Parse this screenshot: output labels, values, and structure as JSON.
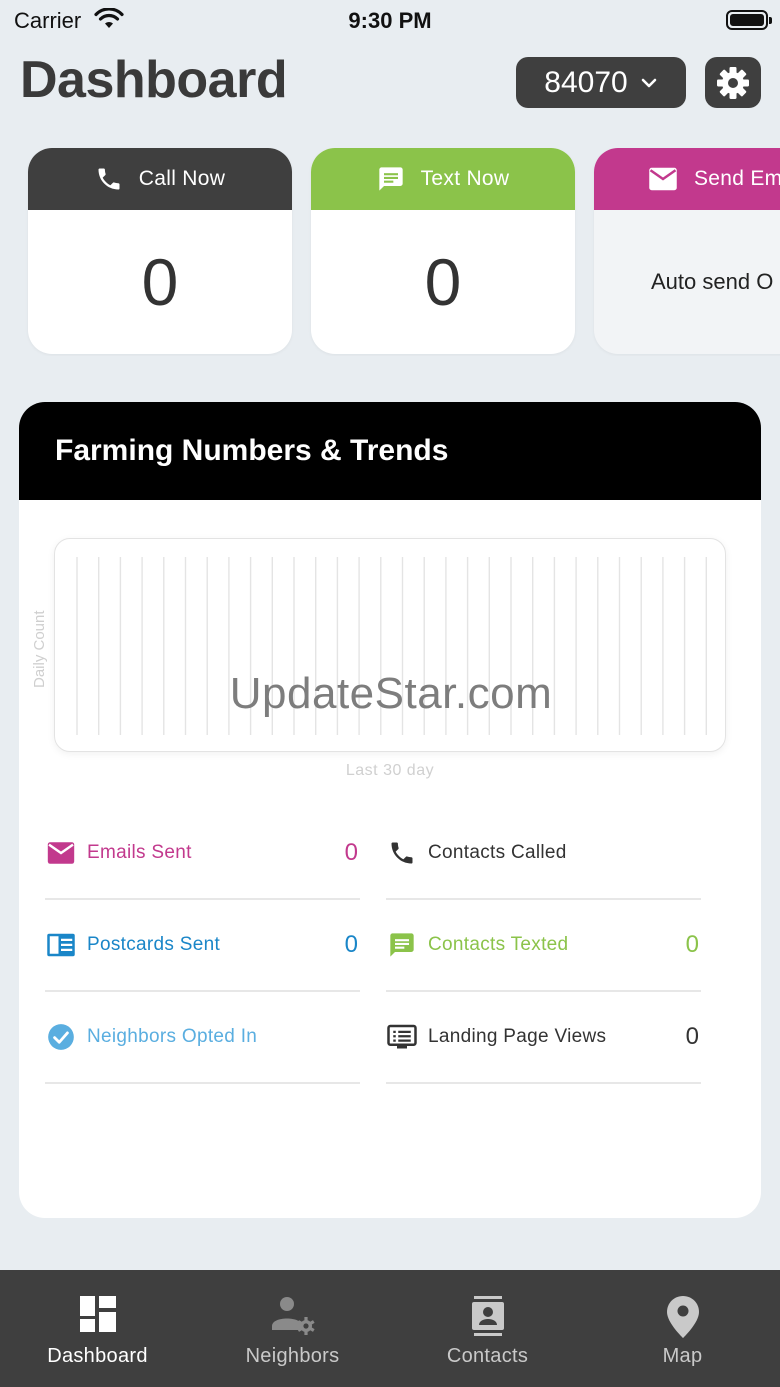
{
  "status_bar": {
    "carrier": "Carrier",
    "time": "9:30 PM"
  },
  "header": {
    "title": "Dashboard",
    "zip": "84070"
  },
  "action_cards": {
    "call": {
      "label": "Call Now",
      "count": "0"
    },
    "text": {
      "label": "Text Now",
      "count": "0"
    },
    "email": {
      "label": "Send Em",
      "body": "Auto send O"
    }
  },
  "trends": {
    "title": "Farming Numbers & Trends",
    "chart_watermark": "UpdateStar.com",
    "y_axis_label": "Daily Count",
    "x_axis_label": "Last 30 day",
    "stats": {
      "emails_sent": {
        "label": "Emails Sent",
        "value": "0",
        "color": "#c2398d"
      },
      "contacts_called": {
        "label": "Contacts Called",
        "value": "",
        "color": "#333333"
      },
      "postcards_sent": {
        "label": "Postcards Sent",
        "value": "0",
        "color": "#1a86c8"
      },
      "contacts_texted": {
        "label": "Contacts Texted",
        "value": "0",
        "color": "#8bc34a"
      },
      "neighbors_opted_in": {
        "label": "Neighbors Opted In",
        "value": "",
        "color": "#5aaee0"
      },
      "landing_page_views": {
        "label": "Landing Page Views",
        "value": "0",
        "color": "#333333"
      }
    }
  },
  "tabbar": {
    "dashboard": "Dashboard",
    "neighbors": "Neighbors",
    "contacts": "Contacts",
    "map": "Map"
  }
}
